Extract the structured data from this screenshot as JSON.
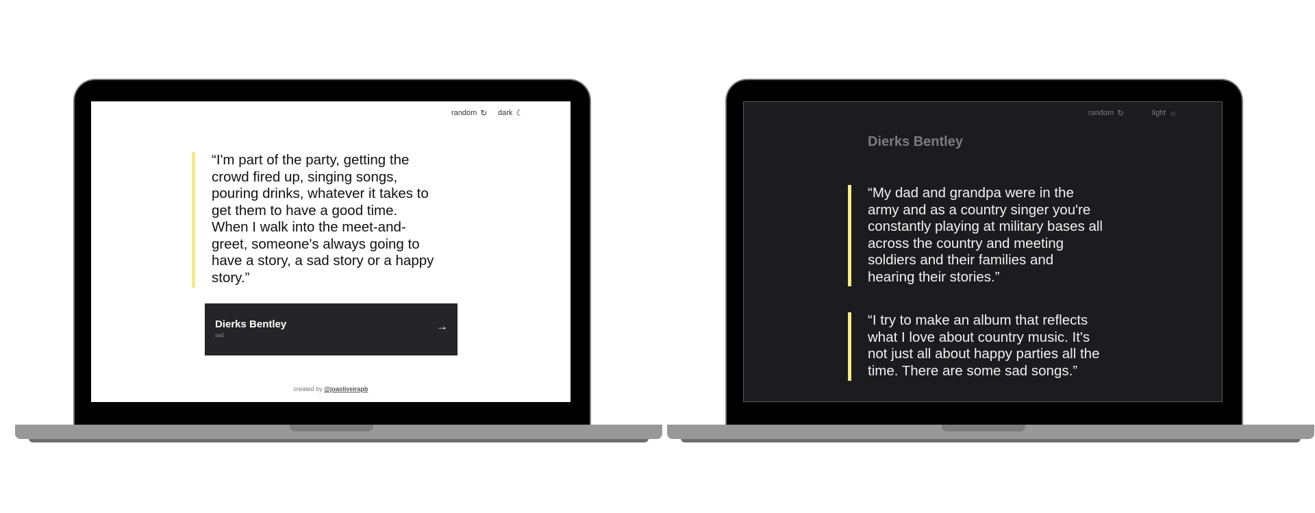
{
  "left_app": {
    "nav": {
      "random_label": "random",
      "random_icon": "refresh-icon",
      "mode_label": "dark",
      "mode_icon": "moon-icon"
    },
    "quote": "“I'm part of the party, getting the crowd fired up, singing songs, pouring drinks, whatever it takes to get them to have a good time. When I walk into the meet-and-greet, someone's always going to have a story, a sad story or a happy story.”",
    "author_card": {
      "name": "Dierks Bentley",
      "tag": "sad",
      "arrow": "→"
    },
    "footer": {
      "prefix": "created by",
      "handle": "@joaoliveirapb"
    }
  },
  "right_app": {
    "nav": {
      "random_label": "random",
      "random_icon": "refresh-icon",
      "mode_label": "light",
      "mode_icon": "sun-icon"
    },
    "author": "Dierks Bentley",
    "quotes": [
      "“My dad and grandpa were in the army and as a country singer you're constantly playing at military bases all across the country and meeting soldiers and their families and hearing their stories.”",
      "“I try to make an album that reflects what I love about country music. It's not just all about happy parties all the time. There are some sad songs.”"
    ]
  },
  "colors": {
    "accent_bar": "#f5e98c",
    "dark_bg": "#1c1c1e",
    "card_bg": "#252527"
  }
}
